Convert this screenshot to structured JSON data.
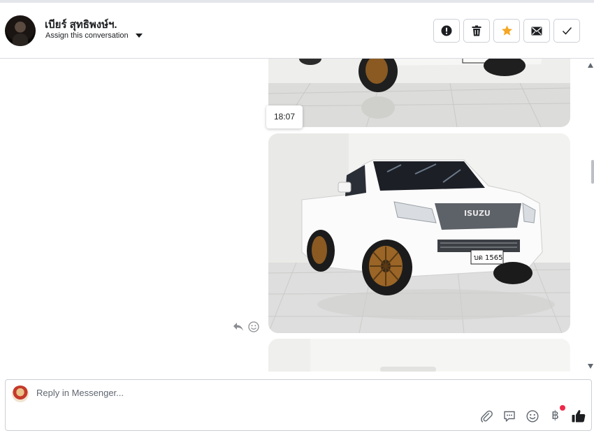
{
  "header": {
    "contact_name": "เบียร์ สุทธิพงษ์ฯ.",
    "assign_label": "Assign this conversation",
    "actions": [
      {
        "name": "report-spam-button",
        "icon": "exclamation-circle-icon"
      },
      {
        "name": "delete-button",
        "icon": "trash-icon"
      },
      {
        "name": "star-button",
        "icon": "star-icon",
        "color": "#f5a623"
      },
      {
        "name": "mark-unread-button",
        "icon": "envelope-icon"
      },
      {
        "name": "mark-done-button",
        "icon": "checkmark-icon"
      }
    ]
  },
  "thread": {
    "timestamp": "18:07",
    "message_tools": [
      "reply-icon",
      "emoji-react-icon"
    ],
    "photo_text": {
      "grille_brand": "ISUZU",
      "license_plate": "บด 1565"
    }
  },
  "composer": {
    "placeholder": "Reply in Messenger...",
    "tools": [
      "paperclip-icon",
      "saved-reply-icon",
      "emoji-icon",
      "baht-payment-icon",
      "thumbs-up-icon"
    ],
    "baht_symbol": "฿",
    "notification_color": "#f02849"
  }
}
